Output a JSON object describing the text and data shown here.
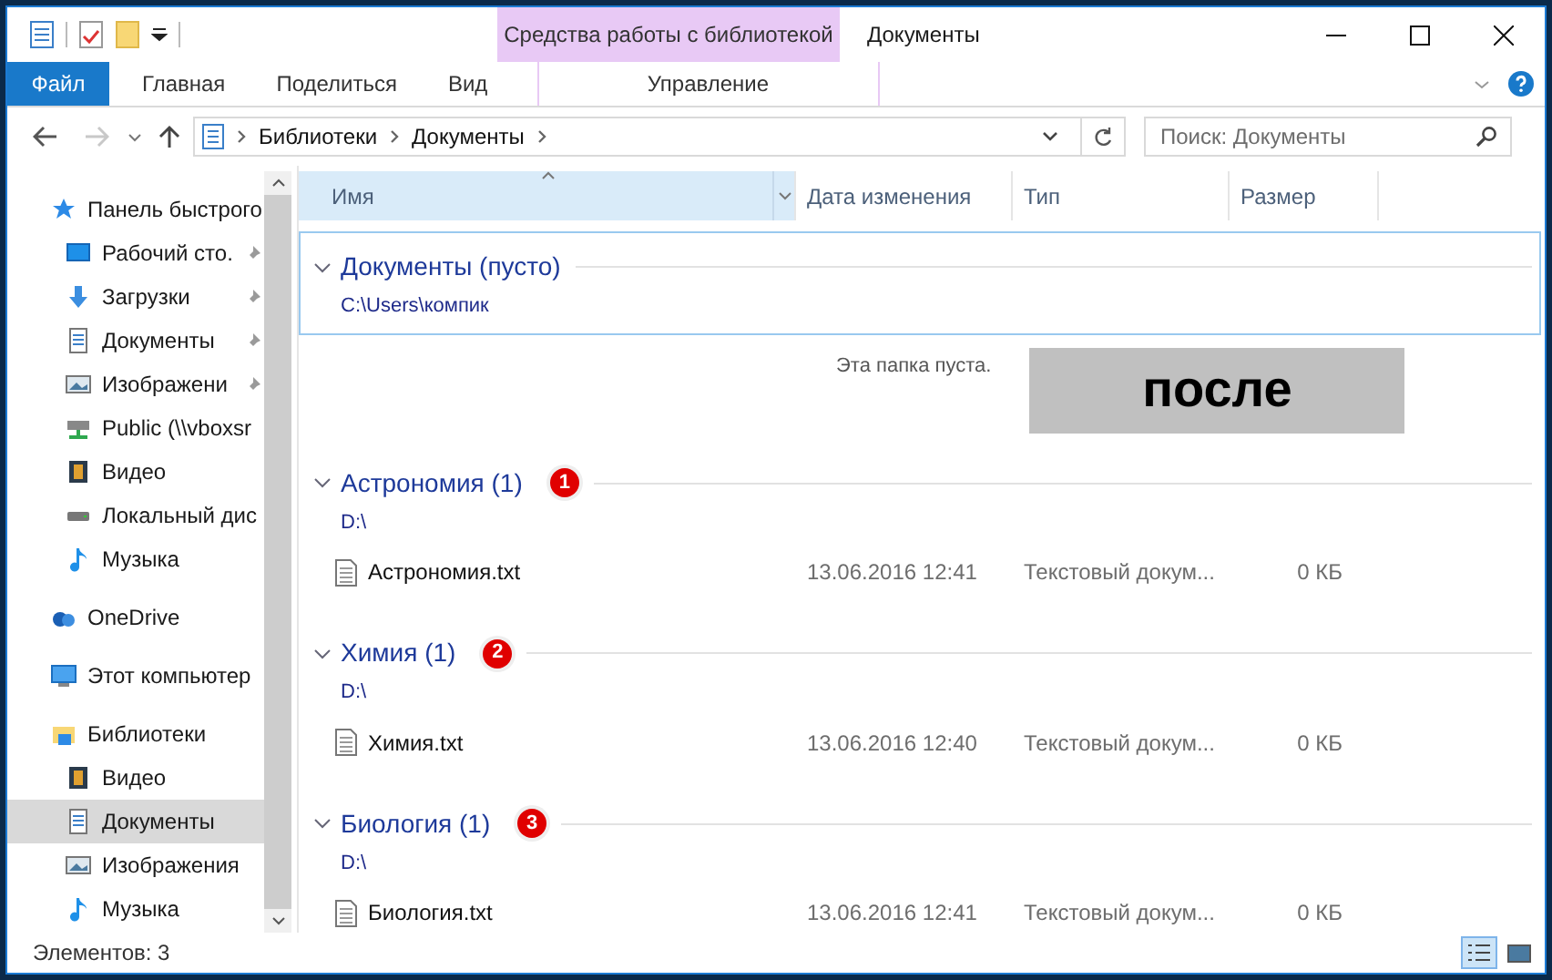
{
  "window": {
    "title": "Документы"
  },
  "context_tab": {
    "label": "Средства работы с библиотекой"
  },
  "ribbon_tabs": [
    {
      "label": "Файл",
      "kind": "file"
    },
    {
      "label": "Главная",
      "kind": "tab"
    },
    {
      "label": "Поделиться",
      "kind": "tab"
    },
    {
      "label": "Вид",
      "kind": "tab"
    },
    {
      "label": "Управление",
      "kind": "context"
    }
  ],
  "navigation": {
    "back_disabled": false,
    "forward_disabled": true
  },
  "address": {
    "crumbs": [
      "Библиотеки",
      "Документы"
    ]
  },
  "search": {
    "placeholder": "Поиск: Документы"
  },
  "sidebar": {
    "items": [
      {
        "label": "Панель быстрого",
        "kind": "star",
        "children": [
          {
            "label": "Рабочий сто.",
            "kind": "desktop",
            "pinned": true
          },
          {
            "label": "Загрузки",
            "kind": "download",
            "pinned": true
          },
          {
            "label": "Документы",
            "kind": "document",
            "pinned": true
          },
          {
            "label": "Изображени",
            "kind": "pictures",
            "pinned": true
          },
          {
            "label": "Public (\\\\vboxsr",
            "kind": "netdrive",
            "pinned": false
          },
          {
            "label": "Видео",
            "kind": "video",
            "pinned": false
          },
          {
            "label": "Локальный дис",
            "kind": "drive",
            "pinned": false
          },
          {
            "label": "Музыка",
            "kind": "music",
            "pinned": false
          }
        ]
      },
      {
        "label": "OneDrive",
        "kind": "cloud"
      },
      {
        "label": "Этот компьютер",
        "kind": "computer"
      },
      {
        "label": "Библиотеки",
        "kind": "library",
        "children": [
          {
            "label": "Видео",
            "kind": "video",
            "selected": false
          },
          {
            "label": "Документы",
            "kind": "document",
            "selected": true
          },
          {
            "label": "Изображения",
            "kind": "pictures",
            "selected": false
          },
          {
            "label": "Музыка",
            "kind": "music",
            "selected": false
          }
        ]
      }
    ]
  },
  "table": {
    "columns": [
      {
        "label": "Имя",
        "selected": true
      },
      {
        "label": "Дата изменения",
        "selected": false
      },
      {
        "label": "Тип",
        "selected": false
      },
      {
        "label": "Размер",
        "selected": false
      }
    ],
    "groups": [
      {
        "title": "Документы (пусто)",
        "path": "C:\\Users\\компик",
        "focused": true,
        "empty_message": "Эта папка пуста."
      },
      {
        "title": "Астрономия (1)",
        "marker": "1",
        "path": "D:\\",
        "focused": false,
        "rows": [
          {
            "name": "Астрономия.txt",
            "date": "13.06.2016 12:41",
            "type": "Текстовый докум...",
            "size": "0 КБ"
          }
        ]
      },
      {
        "title": "Химия (1)",
        "marker": "2",
        "path": "D:\\",
        "focused": false,
        "rows": [
          {
            "name": "Химия.txt",
            "date": "13.06.2016 12:40",
            "type": "Текстовый докум...",
            "size": "0 КБ"
          }
        ]
      },
      {
        "title": "Биология (1)",
        "marker": "3",
        "path": "D:\\",
        "focused": false,
        "rows": [
          {
            "name": "Биология.txt",
            "date": "13.06.2016 12:41",
            "type": "Текстовый докум...",
            "size": "0 КБ"
          }
        ]
      }
    ]
  },
  "overlay_label": "после",
  "status_bar": {
    "text": "Элементов: 3",
    "views": [
      {
        "kind": "details",
        "selected": true
      },
      {
        "kind": "thumbnails",
        "selected": false
      }
    ]
  }
}
